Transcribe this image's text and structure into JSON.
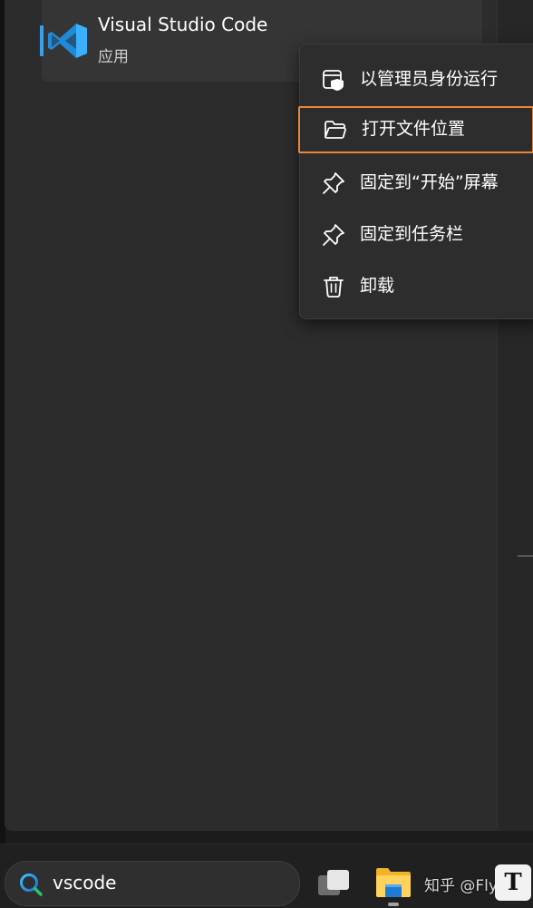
{
  "result": {
    "app_name": "Visual Studio Code",
    "app_type": "应用",
    "logo_icon": "vscode-logo-icon",
    "accent_color": "#2aa0f0"
  },
  "context_menu": {
    "items": [
      {
        "label": "以管理员身份运行",
        "icon": "shield-window-icon"
      },
      {
        "label": "打开文件位置",
        "icon": "folder-open-icon",
        "highlighted": true
      },
      {
        "label": "固定到“开始”屏幕",
        "icon": "pin-icon"
      },
      {
        "label": "固定到任务栏",
        "icon": "pin-icon"
      },
      {
        "label": "卸载",
        "icon": "trash-icon"
      }
    ],
    "highlight_color": "#e8873a"
  },
  "taskbar": {
    "search_value": "vscode",
    "search_icon": "search-icon",
    "apps": [
      {
        "icon": "task-view-icon"
      },
      {
        "icon": "file-explorer-icon"
      },
      {
        "icon": "typora-icon",
        "glyph": "T"
      }
    ],
    "watermark": "知乎 @Flyrd"
  }
}
